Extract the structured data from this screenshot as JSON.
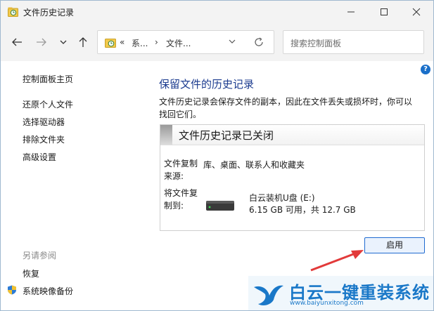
{
  "window": {
    "title": "文件历史记录",
    "app_icon": "file-history-icon"
  },
  "navigation": {
    "back_icon": "arrow-left-icon",
    "forward_icon": "arrow-right-icon",
    "recent_icon": "chevron-down-icon",
    "up_icon": "arrow-up-icon",
    "breadcrumb": {
      "overflow": "«",
      "item1": "系...",
      "sep": "›",
      "item2": "文件..."
    },
    "refresh_icon": "refresh-icon",
    "search_placeholder": "搜索控制面板"
  },
  "sidebar": {
    "home": "控制面板主页",
    "items": [
      "还原个人文件",
      "选择驱动器",
      "排除文件夹",
      "高级设置"
    ],
    "see_also_title": "另请参阅",
    "see_also": [
      "恢复",
      "系统映像备份"
    ]
  },
  "main": {
    "heading": "保留文件的历史记录",
    "description": "文件历史记录会保存文件的副本，因此在文件丢失或损坏时，你可以找回它们。",
    "status_title": "文件历史记录已关闭",
    "source_label": "文件复制来源:",
    "source_value": "库、桌面、联系人和收藏夹",
    "target_label": "将文件复制到:",
    "drive_name": "白云装机U盘 (E:)",
    "drive_space": "6.15 GB 可用，共 12.7 GB",
    "enable_button": "启用"
  },
  "watermark": {
    "brand": "白云一键重装系统",
    "url": "www.baiyunxitong.com"
  },
  "colors": {
    "accent": "#1a6fc9",
    "heading": "#1b3b8f",
    "arrow": "#e23a3a",
    "watermark": "#1a78c8"
  }
}
